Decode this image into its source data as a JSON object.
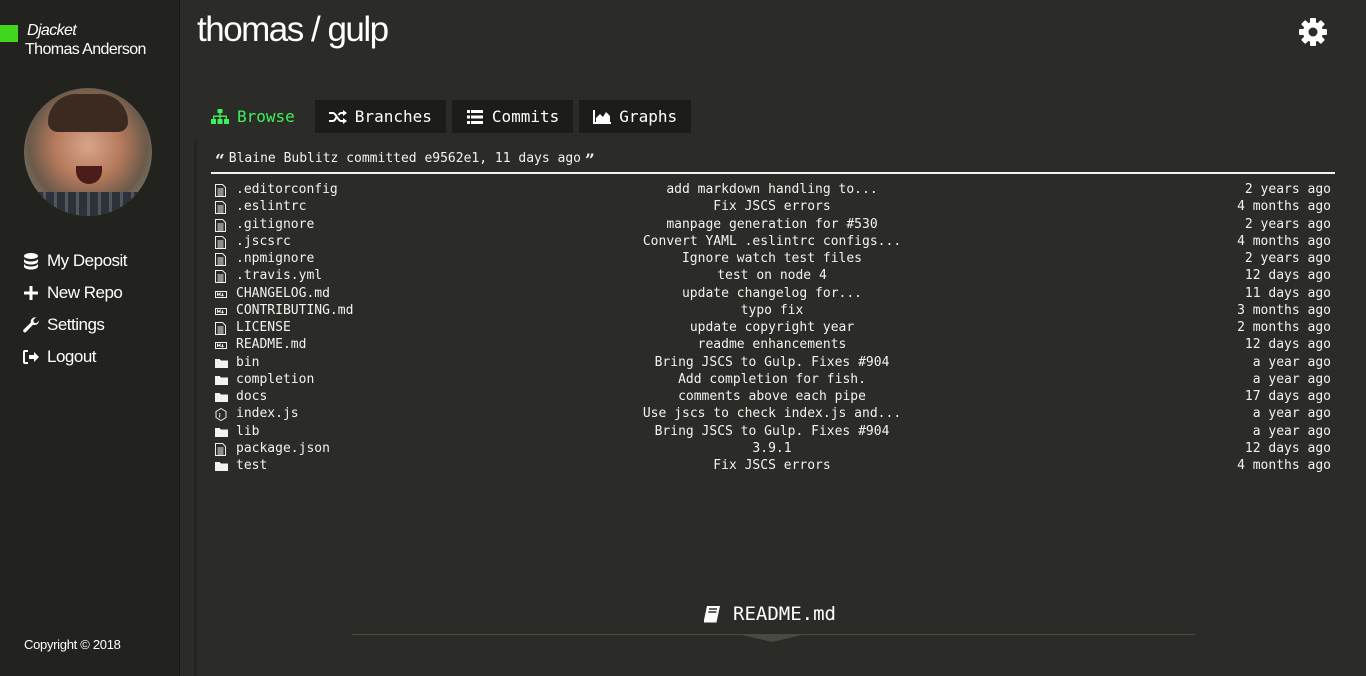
{
  "sidebar": {
    "app_name": "Djacket",
    "user_name": "Thomas Anderson",
    "nav": [
      {
        "label": "My Deposit",
        "icon": "database-icon"
      },
      {
        "label": "New Repo",
        "icon": "plus-icon"
      },
      {
        "label": "Settings",
        "icon": "wrench-icon"
      },
      {
        "label": "Logout",
        "icon": "sign-out-icon"
      }
    ],
    "copyright": "Copyright © 2018"
  },
  "header": {
    "repo_title": "thomas / gulp",
    "settings_icon": "gear-icon"
  },
  "tabs": [
    {
      "label": "Browse",
      "icon": "sitemap-icon",
      "active": true
    },
    {
      "label": "Branches",
      "icon": "shuffle-icon",
      "active": false
    },
    {
      "label": "Commits",
      "icon": "list-icon",
      "active": false
    },
    {
      "label": "Graphs",
      "icon": "area-chart-icon",
      "active": false
    }
  ],
  "commit": {
    "text": "Blaine Bublitz committed e9562e1, 11 days ago"
  },
  "files": [
    {
      "name": ".editorconfig",
      "message": "add markdown handling to...",
      "date": "2 years ago",
      "icon": "file-text-icon"
    },
    {
      "name": ".eslintrc",
      "message": "Fix JSCS errors",
      "date": "4 months ago",
      "icon": "file-text-icon"
    },
    {
      "name": ".gitignore",
      "message": "manpage generation for #530",
      "date": "2 years ago",
      "icon": "file-text-icon"
    },
    {
      "name": ".jscsrc",
      "message": "Convert YAML .eslintrc configs...",
      "date": "4 months ago",
      "icon": "file-text-icon"
    },
    {
      "name": ".npmignore",
      "message": "Ignore watch test files",
      "date": "2 years ago",
      "icon": "file-text-icon"
    },
    {
      "name": ".travis.yml",
      "message": "test on node 4",
      "date": "12 days ago",
      "icon": "file-text-icon"
    },
    {
      "name": "CHANGELOG.md",
      "message": "update changelog for...",
      "date": "11 days ago",
      "icon": "markdown-icon"
    },
    {
      "name": "CONTRIBUTING.md",
      "message": "typo fix",
      "date": "3 months ago",
      "icon": "markdown-icon"
    },
    {
      "name": "LICENSE",
      "message": "update copyright year",
      "date": "2 months ago",
      "icon": "file-text-icon"
    },
    {
      "name": "README.md",
      "message": "readme enhancements",
      "date": "12 days ago",
      "icon": "markdown-icon"
    },
    {
      "name": "bin",
      "message": "Bring JSCS to Gulp. Fixes #904",
      "date": "a year ago",
      "icon": "folder-icon"
    },
    {
      "name": "completion",
      "message": "Add completion for fish.",
      "date": "a year ago",
      "icon": "folder-icon"
    },
    {
      "name": "docs",
      "message": "comments above each pipe",
      "date": "17 days ago",
      "icon": "folder-icon"
    },
    {
      "name": "index.js",
      "message": "Use jscs to check index.js and...",
      "date": "a year ago",
      "icon": "js-icon"
    },
    {
      "name": "lib",
      "message": "Bring JSCS to Gulp. Fixes #904",
      "date": "a year ago",
      "icon": "folder-icon"
    },
    {
      "name": "package.json",
      "message": "3.9.1",
      "date": "12 days ago",
      "icon": "file-text-icon"
    },
    {
      "name": "test",
      "message": "Fix JSCS errors",
      "date": "4 months ago",
      "icon": "folder-icon"
    }
  ],
  "readme": {
    "title": "README.md",
    "icon": "book-icon"
  },
  "colors": {
    "accent": "#3fd61b",
    "active_tab": "#3ff05a",
    "background": "#2b2b27",
    "sidebar": "#22221f"
  }
}
